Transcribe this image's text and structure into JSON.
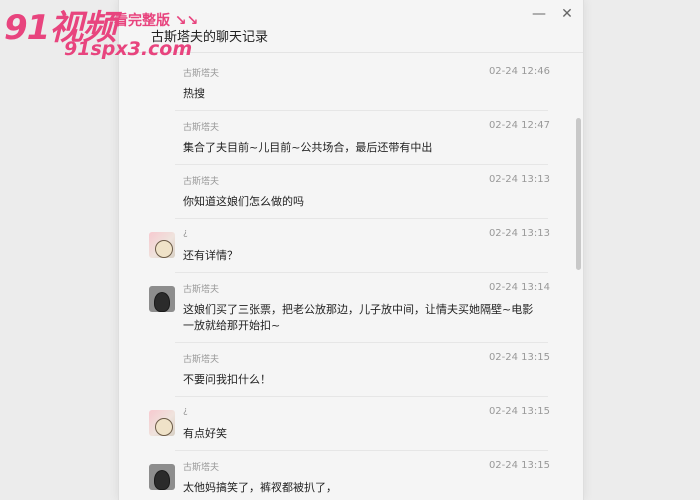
{
  "watermark": {
    "logo": "91视频",
    "tagline": "看完整版 ↘↘",
    "url": "91spx3.com"
  },
  "window": {
    "title": "古斯塔夫的聊天记录",
    "min_icon": "minimize-icon",
    "close_icon": "close-icon"
  },
  "messages": [
    {
      "sender": "古斯塔夫",
      "time": "02-24 12:46",
      "text": "热搜",
      "avatar": "none"
    },
    {
      "sender": "古斯塔夫",
      "time": "02-24 12:47",
      "text": "集合了夫目前~儿目前~公共场合，最后还带有中出",
      "avatar": "none"
    },
    {
      "sender": "古斯塔夫",
      "time": "02-24 13:13",
      "text": "你知道这娘们怎么做的吗",
      "avatar": "none"
    },
    {
      "sender": "¿",
      "time": "02-24 13:13",
      "text": "还有详情？",
      "avatar": "pink"
    },
    {
      "sender": "古斯塔夫",
      "time": "02-24 13:14",
      "text": "这娘们买了三张票，把老公放那边，儿子放中间，让情夫买她隔壁~电影一放就给那开始扣~",
      "avatar": "dark"
    },
    {
      "sender": "古斯塔夫",
      "time": "02-24 13:15",
      "text": "不要问我扣什么！",
      "avatar": "none"
    },
    {
      "sender": "¿",
      "time": "02-24 13:15",
      "text": "有点好笑",
      "avatar": "pink"
    },
    {
      "sender": "古斯塔夫",
      "time": "02-24 13:15",
      "text": "太他妈搞笑了，裤衩都被扒了，",
      "avatar": "dark"
    }
  ],
  "colors": {
    "accent": "#e8447e",
    "background": "#f5f5f5"
  }
}
